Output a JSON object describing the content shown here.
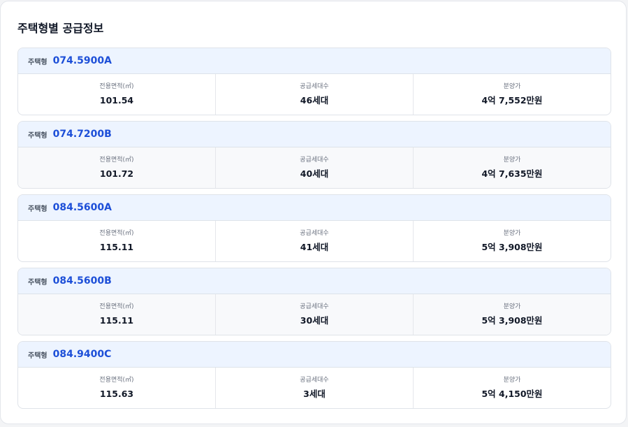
{
  "section": {
    "title": "주택형별 공급정보"
  },
  "labels": {
    "type_label": "주택형",
    "area": "전용면적(㎡)",
    "households": "공급세대수",
    "price": "분양가"
  },
  "units": [
    {
      "code": "074.5900A",
      "area": "101.54",
      "households": "46세대",
      "price": "4억 7,552만원"
    },
    {
      "code": "074.7200B",
      "area": "101.72",
      "households": "40세대",
      "price": "4억 7,635만원"
    },
    {
      "code": "084.5600A",
      "area": "115.11",
      "households": "41세대",
      "price": "5억 3,908만원"
    },
    {
      "code": "084.5600B",
      "area": "115.11",
      "households": "30세대",
      "price": "5억 3,908만원"
    },
    {
      "code": "084.9400C",
      "area": "115.63",
      "households": "3세대",
      "price": "5억 4,150만원"
    }
  ]
}
